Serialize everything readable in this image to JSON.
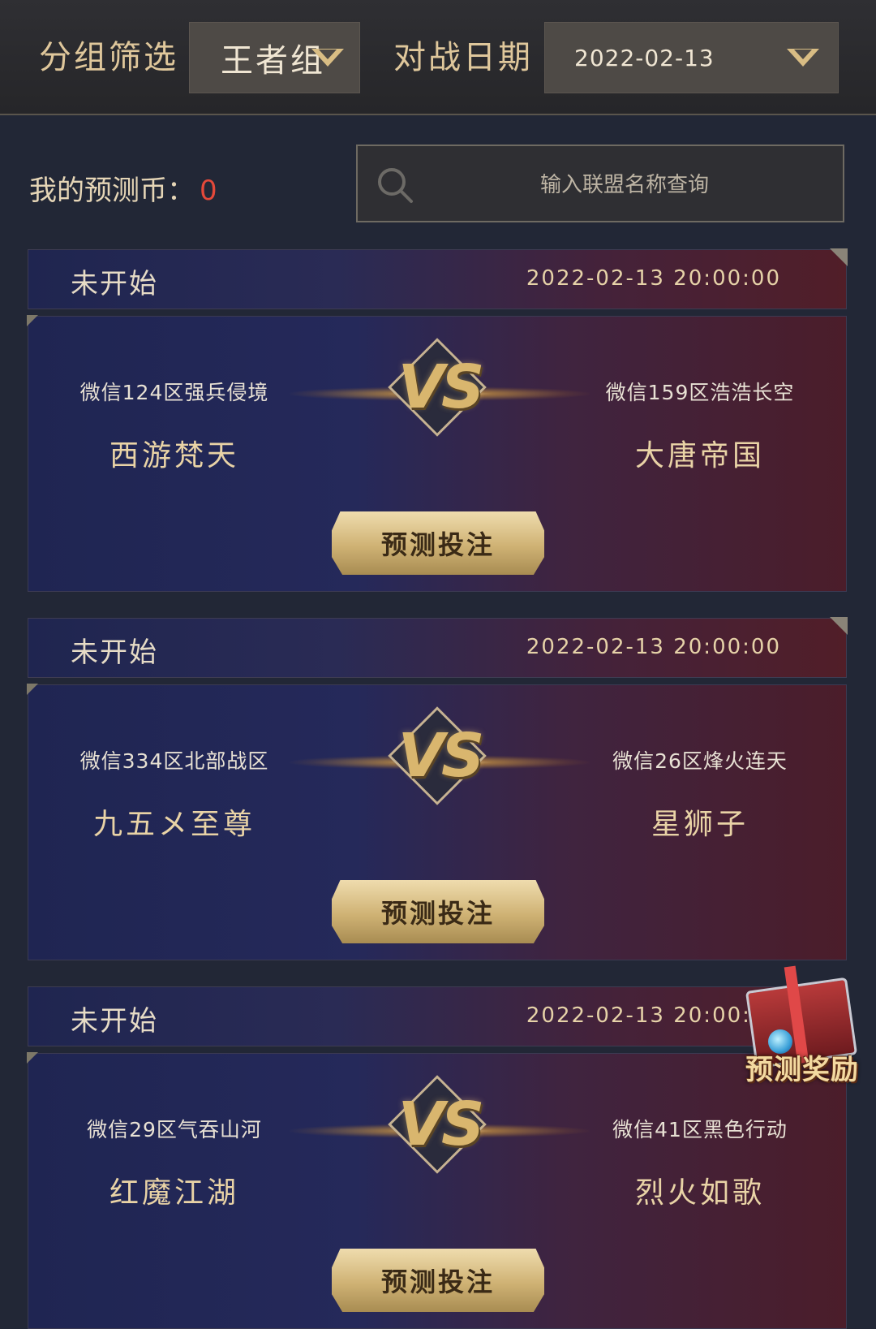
{
  "filter": {
    "group_label": "分组筛选",
    "group_value": "王者组",
    "date_label": "对战日期",
    "date_value": "2022-02-13"
  },
  "coins": {
    "label": "我的预测币：",
    "value": "0"
  },
  "search": {
    "placeholder": "输入联盟名称查询"
  },
  "matches": [
    {
      "status": "未开始",
      "time": "2022-02-13 20:00:00",
      "left": {
        "server": "微信124区强兵侵境",
        "alliance": "西游梵天"
      },
      "right": {
        "server": "微信159区浩浩长空",
        "alliance": "大唐帝国"
      },
      "vs": "VS",
      "button": "预测投注"
    },
    {
      "status": "未开始",
      "time": "2022-02-13 20:00:00",
      "left": {
        "server": "微信334区北部战区",
        "alliance": "九五メ至尊"
      },
      "right": {
        "server": "微信26区烽火连天",
        "alliance": "星狮子"
      },
      "vs": "VS",
      "button": "预测投注"
    },
    {
      "status": "未开始",
      "time": "2022-02-13 20:00:00",
      "left": {
        "server": "微信29区气吞山河",
        "alliance": "红魔江湖"
      },
      "right": {
        "server": "微信41区黑色行动",
        "alliance": "烈火如歌"
      },
      "vs": "VS",
      "button": "预测投注"
    }
  ],
  "gift": {
    "label": "预测奖励",
    "icon": "gift-box-icon"
  },
  "colors": {
    "gold": "#d9bd84",
    "coin_red": "#e4493a",
    "blue_side": "#1f2552",
    "red_side": "#4b1d2a"
  }
}
